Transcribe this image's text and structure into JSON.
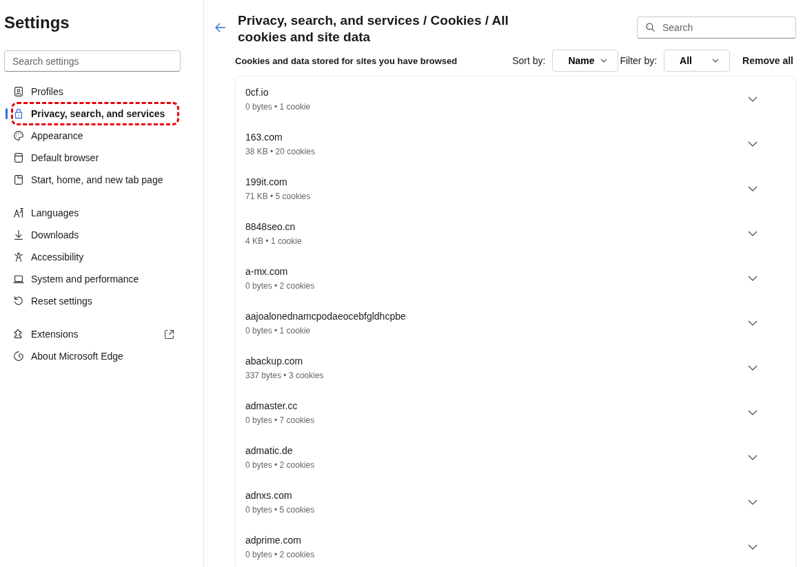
{
  "sidebar": {
    "title": "Settings",
    "search": {
      "placeholder": "Search settings"
    },
    "groups": [
      [
        {
          "label": "Profiles",
          "selected": false,
          "highlighted": false,
          "external": false
        },
        {
          "label": "Privacy, search, and services",
          "selected": true,
          "highlighted": true,
          "external": false
        },
        {
          "label": "Appearance",
          "selected": false,
          "highlighted": false,
          "external": false
        },
        {
          "label": "Default browser",
          "selected": false,
          "highlighted": false,
          "external": false
        },
        {
          "label": "Start, home, and new tab page",
          "selected": false,
          "highlighted": false,
          "external": false
        }
      ],
      [
        {
          "label": "Languages",
          "selected": false,
          "highlighted": false,
          "external": false
        },
        {
          "label": "Downloads",
          "selected": false,
          "highlighted": false,
          "external": false
        },
        {
          "label": "Accessibility",
          "selected": false,
          "highlighted": false,
          "external": false
        },
        {
          "label": "System and performance",
          "selected": false,
          "highlighted": false,
          "external": false
        },
        {
          "label": "Reset settings",
          "selected": false,
          "highlighted": false,
          "external": false
        }
      ],
      [
        {
          "label": "Extensions",
          "selected": false,
          "highlighted": false,
          "external": true
        },
        {
          "label": "About Microsoft Edge",
          "selected": false,
          "highlighted": false,
          "external": false
        }
      ]
    ]
  },
  "main": {
    "breadcrumb": "Privacy, search, and services / Cookies / All cookies and site data",
    "search": {
      "placeholder": "Search"
    },
    "subtitle": "Cookies and data stored for sites you have browsed",
    "sort_label": "Sort by:",
    "sort_value": "Name",
    "filter_label": "Filter by:",
    "filter_value": "All",
    "remove_all": "Remove all",
    "sites": [
      {
        "name": "0cf.io",
        "details": "0 bytes • 1 cookie"
      },
      {
        "name": "163.com",
        "details": "38 KB • 20 cookies"
      },
      {
        "name": "199it.com",
        "details": "71 KB • 5 cookies"
      },
      {
        "name": "8848seo.cn",
        "details": "4 KB • 1 cookie"
      },
      {
        "name": "a-mx.com",
        "details": "0 bytes • 2 cookies"
      },
      {
        "name": "aajoalonednamcpodaeocebfgldhcpbe",
        "details": "0 bytes • 1 cookie"
      },
      {
        "name": "abackup.com",
        "details": "337 bytes • 3 cookies"
      },
      {
        "name": "admaster.cc",
        "details": "0 bytes • 7 cookies"
      },
      {
        "name": "admatic.de",
        "details": "0 bytes • 2 cookies"
      },
      {
        "name": "adnxs.com",
        "details": "0 bytes • 5 cookies"
      },
      {
        "name": "adprime.com",
        "details": "0 bytes • 2 cookies"
      }
    ]
  }
}
